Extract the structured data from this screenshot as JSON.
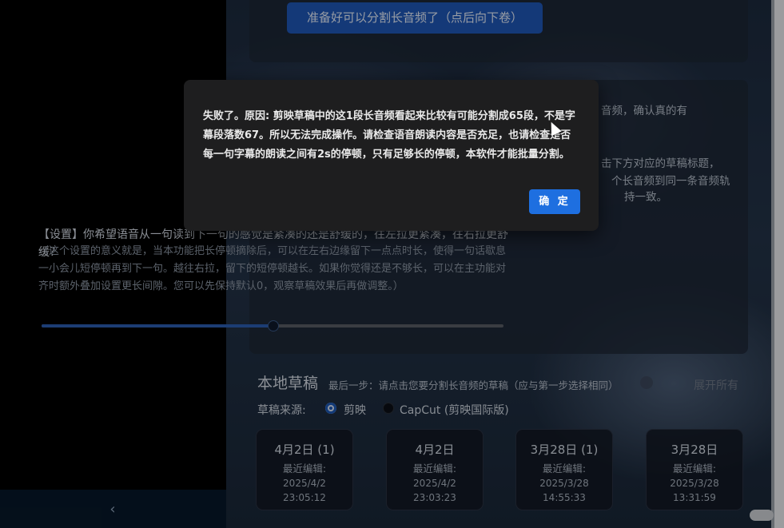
{
  "top_card": {
    "ready_button": "准备好可以分割长音频了（点后向下卷）"
  },
  "settings_card": {
    "frag_1": "音频，确认真的有",
    "frag_2": "击下方对应的草稿标题，",
    "frag_3": "个长音频到同一条音频轨",
    "frag_4": "持一致。",
    "title": "【设置】你希望语音从一句读到下一句的感觉是紧凑的还是舒缓的，往左拉更紧凑，往右拉更舒缓？",
    "description": "（这个设置的意义就是，当本功能把长停顿摘除后，可以在左右边缘留下一点点时长，使得一句话歇息一小会儿短停顿再到下一句。越往右拉，留下的短停顿越长。如果你觉得还是不够长，可以在主功能对齐时额外叠加设置更长间隙。您可以先保持默认0，观察草稿效果后再做调整。）",
    "slider_value": 0.5
  },
  "local_drafts": {
    "title": "本地草稿",
    "subtitle": "最后一步：请点击您要分割长音频的草稿（应与第一步选择相同）",
    "expand_all": "展开所有",
    "source_label": "草稿来源:",
    "source_options": [
      "剪映",
      "CapCut (剪映国际版)"
    ],
    "selected_source": "剪映",
    "recent_edit_label": "最近编辑:",
    "cards": [
      {
        "name": "4月2日 (1)",
        "date": "2025/4/2",
        "time": "23:05:12"
      },
      {
        "name": "4月2日",
        "date": "2025/4/2",
        "time": "23:03:23"
      },
      {
        "name": "3月28日 (1)",
        "date": "2025/3/28",
        "time": "14:55:33"
      },
      {
        "name": "3月28日",
        "date": "2025/3/28",
        "time": "13:31:59"
      }
    ]
  },
  "sidebar": {
    "collapse_icon": "chevron-left-icon",
    "collapse_glyph": "‹"
  },
  "dialog": {
    "message": "失败了。原因: 剪映草稿中的这1段长音频看起来比较有可能分割成65段，不是字幕段落数67。所以无法完成操作。请检查语音朗读内容是否充足，也请检查是否每一句字幕的朗读之间有2s的停顿，只有足够长的停顿，本软件才能批量分割。",
    "ok_button": "确 定"
  },
  "colors": {
    "accent": "#1e6fe0",
    "dialog_bg": "#1e1e1f"
  }
}
